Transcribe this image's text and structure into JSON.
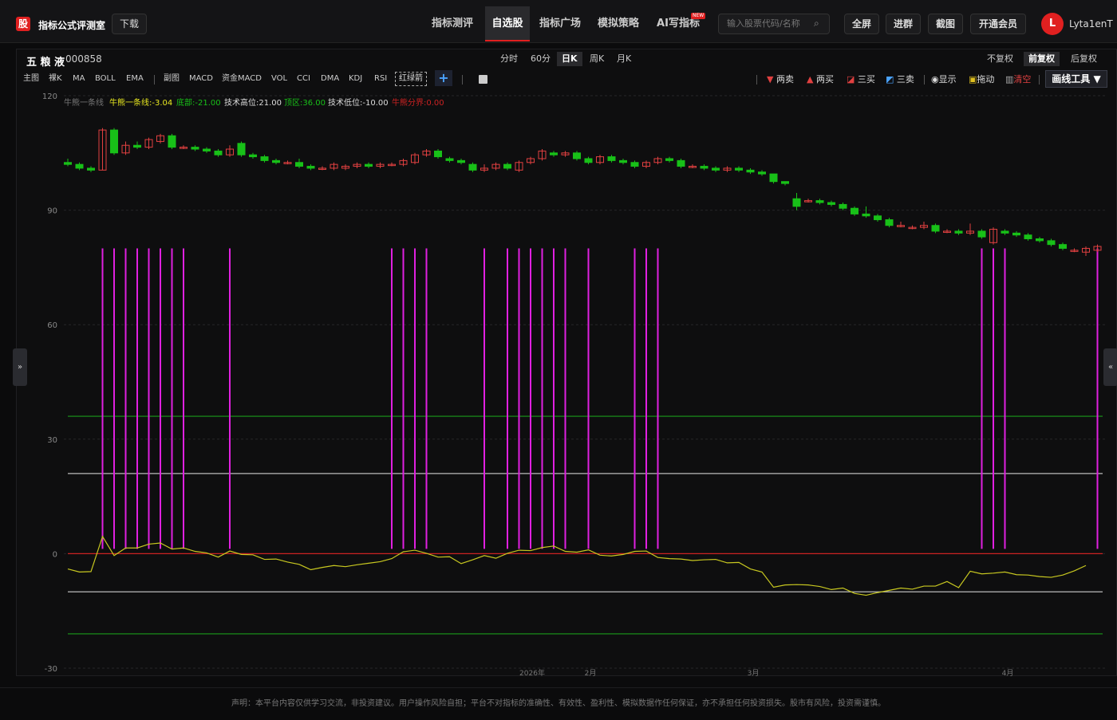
{
  "app": {
    "logo": "股",
    "brand": "指标公式评测室",
    "download": "下载"
  },
  "nav": [
    "指标测评",
    "自选股",
    "指标广场",
    "模拟策略",
    "AI写指标"
  ],
  "nav_active": 1,
  "new_badge": "NEW",
  "search": {
    "placeholder": "输入股票代码/名称"
  },
  "top_buttons": [
    "全屏",
    "进群",
    "截图",
    "开通会员"
  ],
  "user": {
    "avatar": "L",
    "name": "Lyta1enT"
  },
  "stock": {
    "name": "五 粮 液",
    "code": "000858"
  },
  "periods": [
    "分时",
    "60分",
    "日K",
    "周K",
    "月K"
  ],
  "period_active": 2,
  "adjust": [
    "不复权",
    "前复权",
    "后复权"
  ],
  "adjust_active": 1,
  "indicators_main": [
    "主图",
    "裸K",
    "MA",
    "BOLL",
    "EMA"
  ],
  "indicators_sub": [
    "副图",
    "MACD",
    "资金MACD",
    "VOL",
    "CCI",
    "DMA",
    "KDJ",
    "RSI"
  ],
  "red_green_arrow": "红绿箭",
  "plus_label": "+",
  "tools": {
    "two_sell": "两卖",
    "two_buy": "两买",
    "three_buy": "三买",
    "three_sell": "三卖",
    "show": "显示",
    "drag": "拖动",
    "clear": "清空",
    "draw_tools": "画线工具 ▼"
  },
  "legend": {
    "series": "牛熊一条线",
    "line_val": "牛熊一条线:-3.04",
    "bottom": "底部:-21.00",
    "tech_high": "技术高位:21.00",
    "top_zone": "顶区:36.00",
    "tech_low": "技术低位:-10.00",
    "split": "牛熊分界:0.00"
  },
  "y_ticks": [
    "120",
    "90",
    "60",
    "30",
    "0",
    "-30"
  ],
  "x_ticks": [
    "2026年",
    "2月",
    "3月",
    "4月"
  ],
  "colors": {
    "up": "#e04040",
    "down": "#18c018",
    "signal": "#e020e0",
    "line": "#c8c820",
    "top_zone": "#1a9a1a",
    "tech_high": "#bbbbbb",
    "split": "#cc2222",
    "tech_low": "#bbbbbb",
    "bottom": "#1a9a1a"
  },
  "chart_data": {
    "type": "candlestick",
    "ylim": [
      -30,
      120
    ],
    "candles": [
      [
        102.5,
        102,
        103.5,
        101.5
      ],
      [
        102,
        101,
        102.5,
        100.5
      ],
      [
        101,
        100.5,
        101.5,
        100
      ],
      [
        100.5,
        111,
        111.5,
        100.5
      ],
      [
        111,
        105,
        111.5,
        104.5
      ],
      [
        105,
        107,
        108,
        104.5
      ],
      [
        107,
        106.5,
        108,
        106
      ],
      [
        106.5,
        108.5,
        109,
        106
      ],
      [
        108,
        109.5,
        110,
        107.5
      ],
      [
        109.5,
        106.5,
        110,
        106
      ],
      [
        106.5,
        106.5,
        107,
        106
      ],
      [
        106.5,
        106,
        107,
        105.5
      ],
      [
        106,
        105.5,
        106.5,
        105
      ],
      [
        105.5,
        104.5,
        106,
        104
      ],
      [
        104.5,
        106,
        107,
        104
      ],
      [
        107.5,
        104.5,
        108,
        104
      ],
      [
        104.5,
        104,
        105,
        103.5
      ],
      [
        104,
        103,
        104.5,
        102.5
      ],
      [
        103,
        102.5,
        103.5,
        102
      ],
      [
        102.5,
        102.5,
        103,
        102
      ],
      [
        102.5,
        101.5,
        103.5,
        101
      ],
      [
        101.5,
        101,
        102,
        100.5
      ],
      [
        101,
        101,
        101.5,
        100.5
      ],
      [
        101,
        102,
        102.5,
        100.5
      ],
      [
        101,
        101.5,
        102,
        100.5
      ],
      [
        101.5,
        102,
        102.5,
        101
      ],
      [
        102,
        101.5,
        102.5,
        101
      ],
      [
        101.5,
        102,
        102.5,
        101
      ],
      [
        102,
        102,
        102.5,
        101.5
      ],
      [
        102,
        103,
        103.5,
        101.5
      ],
      [
        102.5,
        104.5,
        105,
        102
      ],
      [
        104.5,
        105.5,
        106,
        104
      ],
      [
        105.5,
        104,
        106,
        103.5
      ],
      [
        103.5,
        103,
        104,
        102.5
      ],
      [
        103,
        102.5,
        103.5,
        102
      ],
      [
        102,
        100.5,
        102.5,
        100
      ],
      [
        100.5,
        101,
        102,
        100
      ],
      [
        101,
        102,
        102.5,
        100.5
      ],
      [
        102,
        101,
        102.5,
        100.5
      ],
      [
        100.5,
        102.5,
        103,
        100
      ],
      [
        102.5,
        103.5,
        104,
        102
      ],
      [
        103.5,
        105.5,
        106,
        103
      ],
      [
        105,
        104.5,
        105.5,
        104
      ],
      [
        104.5,
        105,
        105.5,
        104
      ],
      [
        105,
        103.5,
        105.5,
        103
      ],
      [
        103.5,
        102.5,
        104,
        102
      ],
      [
        102.5,
        104,
        104.5,
        102
      ],
      [
        104,
        103,
        104.5,
        102.5
      ],
      [
        103,
        102.5,
        103.5,
        102
      ],
      [
        102.5,
        101.5,
        103,
        101
      ],
      [
        101.5,
        102.5,
        103,
        101
      ],
      [
        102.5,
        103.5,
        104,
        102
      ],
      [
        103.5,
        103,
        104,
        102.5
      ],
      [
        103,
        101.5,
        103.5,
        101
      ],
      [
        101.5,
        101.5,
        102,
        101
      ],
      [
        101.5,
        101,
        102,
        100.5
      ],
      [
        101,
        100.5,
        101.5,
        100
      ],
      [
        100.5,
        101,
        101.5,
        100
      ],
      [
        101,
        100.5,
        101.5,
        100
      ],
      [
        100.5,
        100,
        101,
        99.5
      ],
      [
        100,
        99.5,
        100.5,
        99
      ],
      [
        99.5,
        97.5,
        98,
        97
      ],
      [
        97.5,
        97,
        97.5,
        96.5
      ],
      [
        93,
        91,
        94.5,
        90
      ],
      [
        92.5,
        92.5,
        93,
        92
      ],
      [
        92.5,
        92,
        93,
        91.5
      ],
      [
        92,
        91.5,
        92.5,
        91
      ],
      [
        91.5,
        90.5,
        92,
        90
      ],
      [
        90.5,
        89,
        91,
        88.5
      ],
      [
        89,
        88.5,
        91,
        88
      ],
      [
        88.5,
        87.5,
        89,
        87
      ],
      [
        87.5,
        86,
        88,
        85.5
      ],
      [
        86,
        86,
        87,
        85.5
      ],
      [
        85.5,
        85.5,
        86,
        85
      ],
      [
        85.5,
        86,
        87,
        85
      ],
      [
        86,
        84.5,
        86.5,
        84
      ],
      [
        84.5,
        84.5,
        85,
        84
      ],
      [
        84.5,
        84,
        85,
        83.5
      ],
      [
        84,
        84.5,
        86.5,
        83.5
      ],
      [
        84.5,
        83,
        85,
        82.5
      ],
      [
        81.5,
        85,
        85.5,
        81
      ],
      [
        84.5,
        84,
        85,
        83.5
      ],
      [
        84,
        83.5,
        84.5,
        83
      ],
      [
        83.5,
        82.5,
        84,
        82
      ],
      [
        82.5,
        82,
        83,
        81.5
      ],
      [
        82,
        81,
        82.5,
        80.5
      ],
      [
        81,
        80,
        81.5,
        79.5
      ],
      [
        79.5,
        79.5,
        80,
        79
      ],
      [
        79,
        80,
        80.5,
        78
      ],
      [
        79.5,
        80.5,
        81,
        79
      ]
    ],
    "line": [
      -4.0,
      -4.8,
      -4.7,
      4.5,
      -0.5,
      1.5,
      1.5,
      2.5,
      2.8,
      1.2,
      1.5,
      0.6,
      0.2,
      -0.9,
      0.7,
      -0.2,
      -0.3,
      -1.5,
      -1.4,
      -2.2,
      -2.8,
      -4.2,
      -3.6,
      -3.1,
      -3.4,
      -2.9,
      -2.5,
      -2.1,
      -1.3,
      0.5,
      0.9,
      0.1,
      -0.9,
      -0.8,
      -2.6,
      -1.6,
      -0.5,
      -1.2,
      0.1,
      0.9,
      0.8,
      1.6,
      2.0,
      0.6,
      0.4,
      1.0,
      -0.4,
      -0.6,
      -0.2,
      0.6,
      0.7,
      -1.0,
      -1.3,
      -1.4,
      -1.8,
      -1.6,
      -1.5,
      -2.4,
      -2.3,
      -4.0,
      -4.8,
      -8.8,
      -8.2,
      -8.1,
      -8.2,
      -8.6,
      -9.4,
      -9.0,
      -10.4,
      -10.9,
      -10.2,
      -9.6,
      -9.0,
      -9.3,
      -8.5,
      -8.5,
      -7.3,
      -8.9,
      -4.6,
      -5.3,
      -5.1,
      -4.8,
      -5.5,
      -5.6,
      -6.0,
      -6.2,
      -5.6,
      -4.5,
      -3.1
    ],
    "signals": [
      3,
      4,
      5,
      6,
      7,
      8,
      9,
      10,
      14,
      28,
      29,
      30,
      31,
      36,
      38,
      39,
      40,
      41,
      42,
      43,
      45,
      49,
      50,
      51,
      79,
      80,
      81,
      89
    ],
    "levels": {
      "top_zone": 36,
      "tech_high": 21,
      "split": 0,
      "tech_low": -10,
      "bottom": -21
    },
    "signal_top": 80
  }
}
